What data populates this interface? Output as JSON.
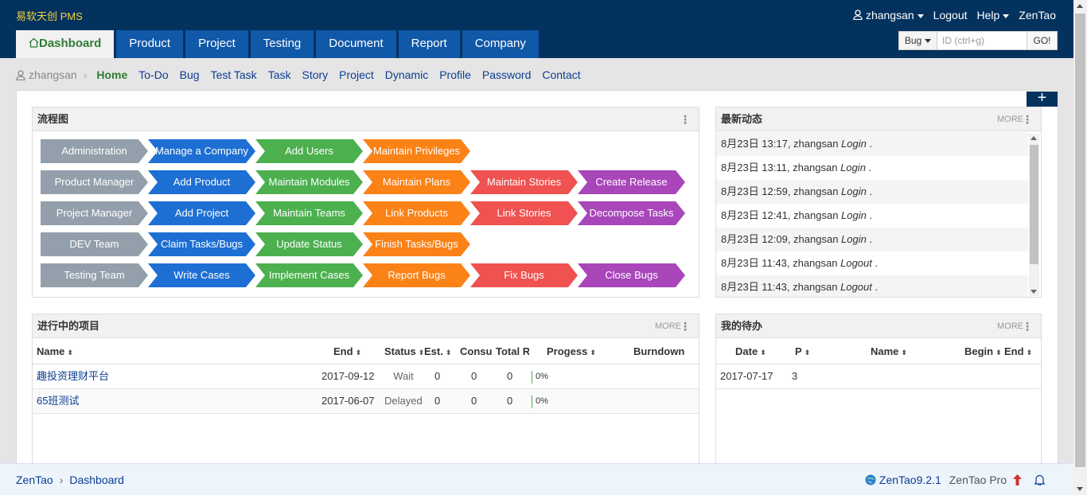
{
  "colors": {
    "topbar": "#03325f",
    "nav_tab": "#1058a8",
    "active_tab_text": "#2e7d32",
    "brand": "#f5d23c",
    "link": "#0b3d91",
    "gray": "#93a0ab",
    "blue": "#1e6fd3",
    "green": "#4cb04f",
    "orange": "#fb8216",
    "red": "#ef5250",
    "purple": "#a846ba"
  },
  "brand": "易软天创 PMS",
  "top_right": {
    "user": "zhangsan",
    "logout": "Logout",
    "help": "Help",
    "zentao": "ZenTao"
  },
  "main_nav": [
    "Dashboard",
    "Product",
    "Project",
    "Testing",
    "Document",
    "Report",
    "Company"
  ],
  "search": {
    "type": "Bug",
    "placeholder": "ID (ctrl+g)",
    "go": "GO!"
  },
  "sub_nav": {
    "user": "zhangsan",
    "items": [
      "Home",
      "To-Do",
      "Bug",
      "Test Task",
      "Task",
      "Story",
      "Project",
      "Dynamic",
      "Profile",
      "Password",
      "Contact"
    ]
  },
  "plus_label": "+",
  "flowchart": {
    "title": "流程图",
    "rows": [
      [
        "Administration",
        "Manage a Company",
        "Add Users",
        "Maintain Privileges"
      ],
      [
        "Product Manager",
        "Add Product",
        "Maintain Modules",
        "Maintain Plans",
        "Maintain Stories",
        "Create Release"
      ],
      [
        "Project Manager",
        "Add Project",
        "Maintain Teams",
        "Link Products",
        "Link Stories",
        "Decompose Tasks"
      ],
      [
        "DEV Team",
        "Claim Tasks/Bugs",
        "Update Status",
        "Finish Tasks/Bugs"
      ],
      [
        "Testing Team",
        "Write Cases",
        "Implement Cases",
        "Report Bugs",
        "Fix Bugs",
        "Close Bugs"
      ]
    ],
    "row_colors": [
      "gray",
      "blue",
      "green",
      "orange",
      "red",
      "purple"
    ]
  },
  "dynamic": {
    "title": "最新动态",
    "more": "MORE",
    "items": [
      {
        "date": "8月23日 13:17, zhangsan",
        "action": "Login",
        "tail": "."
      },
      {
        "date": "8月23日 13:11, zhangsan",
        "action": "Login",
        "tail": "."
      },
      {
        "date": "8月23日 12:59, zhangsan",
        "action": "Login",
        "tail": "."
      },
      {
        "date": "8月23日 12:41, zhangsan",
        "action": "Login",
        "tail": "."
      },
      {
        "date": "8月23日 12:09, zhangsan",
        "action": "Login",
        "tail": "."
      },
      {
        "date": "8月23日 11:43, zhangsan",
        "action": "Logout",
        "tail": "."
      },
      {
        "date": "8月23日 11:43, zhangsan",
        "action": "Logout",
        "tail": "."
      }
    ]
  },
  "projects": {
    "title": "进行中的项目",
    "more": "MORE",
    "columns": {
      "name": "Name",
      "end": "End",
      "status": "Status",
      "est": "Est.",
      "consumed": "Consu",
      "total": "Total R",
      "progress": "Progess",
      "burndown": "Burndown"
    },
    "rows": [
      {
        "name": "趣投资理财平台",
        "end": "2017-09-12",
        "status": "Wait",
        "est": "0",
        "consumed": "0",
        "total": "0",
        "progress": "0%",
        "progress_value": 0
      },
      {
        "name": "65班测试",
        "end": "2017-06-07",
        "status": "Delayed",
        "est": "0",
        "consumed": "0",
        "total": "0",
        "progress": "0%",
        "progress_value": 0
      }
    ]
  },
  "todo": {
    "title": "我的待办",
    "more": "MORE",
    "columns": {
      "date": "Date",
      "pri": "P",
      "name": "Name",
      "begin": "Begin",
      "end": "End"
    },
    "rows": [
      {
        "date": "2017-07-17",
        "pri": "3",
        "name": "",
        "begin": "",
        "end": ""
      }
    ]
  },
  "footer": {
    "crumb_1": "ZenTao",
    "crumb_2": "Dashboard",
    "version": "ZenTao9.2.1",
    "pro": "ZenTao Pro"
  }
}
